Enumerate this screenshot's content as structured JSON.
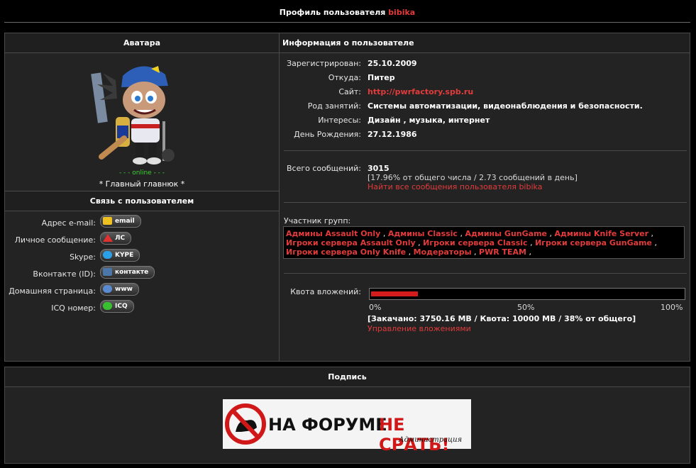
{
  "title": {
    "prefix": "Профиль пользователя",
    "username": "bibika"
  },
  "avatar": {
    "header": "Аватара",
    "status": "- - - online - - -",
    "rank": "* Главный главнюк *"
  },
  "contact": {
    "header": "Связь с пользователем",
    "rows": [
      {
        "label": "Адрес e-mail:",
        "button": "email",
        "icon": "envelope-icon"
      },
      {
        "label": "Личное сообщение:",
        "button": "ЛС",
        "icon": "warning-triangle-icon"
      },
      {
        "label": "Skype:",
        "button": "KYPE",
        "icon": "skype-icon"
      },
      {
        "label": "Вконтакте (ID):",
        "button": "контакте",
        "icon": "vkontakte-icon"
      },
      {
        "label": "Домашняя страница:",
        "button": "www",
        "icon": "globe-icon"
      },
      {
        "label": "ICQ номер:",
        "button": "ICQ",
        "icon": "icq-flower-icon"
      }
    ]
  },
  "info": {
    "header": "Информация о пользователе",
    "rows": [
      {
        "label": "Зарегистрирован:",
        "value": "25.10.2009"
      },
      {
        "label": "Откуда:",
        "value": "Питер"
      },
      {
        "label": "Сайт:",
        "value": "http://pwrfactory.spb.ru"
      },
      {
        "label": "Род занятий:",
        "value": "Системы автоматизации, видеонаблюдения и безопасности."
      },
      {
        "label": "Интересы:",
        "value": "Дизайн , музыка, интернет"
      },
      {
        "label": "День Рождения:",
        "value": "27.12.1986"
      }
    ],
    "posts": {
      "label": "Всего сообщений:",
      "count": "3015",
      "stats": "[17.96% от общего числа / 2.73 сообщений в день]",
      "link": "Найти все сообщения пользователя bibika"
    },
    "groups": {
      "label": "Участник групп:",
      "items": [
        "Админы Assault Only",
        "Админы Classic",
        "Админы GunGame",
        "Админы Knife Server",
        "Игроки сервера Assault Only",
        "Игроки сервера Classic",
        "Игроки сервера GunGame",
        "Игроки сервера Only Knife",
        "Модераторы",
        "PWR TEAM"
      ]
    },
    "quota": {
      "label": "Квота вложений:",
      "fill_fraction": 0.15,
      "ticks": [
        "0%",
        "50%",
        "100%"
      ],
      "text": "[Закачано: 3750.16 MB / Квота: 10000 MB / 38% от общего]",
      "link": "Управление вложениями"
    }
  },
  "signature": {
    "header": "Подпись",
    "banner_text_1": "НА ФОРУМЕ",
    "banner_text_2": "НЕ СРАТЬ!",
    "banner_sub": "Администрация"
  },
  "colors": {
    "accent": "#e23b3b",
    "online": "#3bd12f",
    "quota_fill": "#d41c1c",
    "panel": "#232323"
  }
}
